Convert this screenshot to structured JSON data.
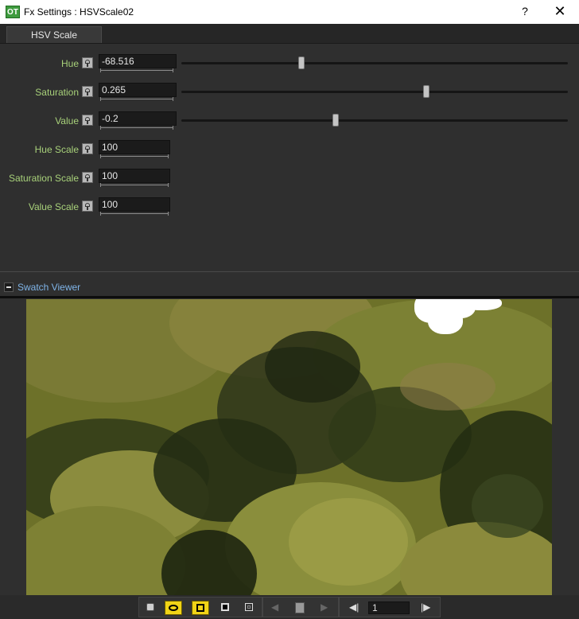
{
  "window": {
    "app_logo_text": "OT",
    "title": "Fx Settings : HSVScale02",
    "help_label": "?",
    "close_label": "✕"
  },
  "tabs": [
    {
      "label": "HSV Scale",
      "active": true
    }
  ],
  "params": [
    {
      "label": "Hue",
      "value": "-68.516",
      "has_slider": true,
      "slider_fraction": 0.31
    },
    {
      "label": "Saturation",
      "value": "0.265",
      "has_slider": true,
      "slider_fraction": 0.633
    },
    {
      "label": "Value",
      "value": "-0.2",
      "has_slider": true,
      "slider_fraction": 0.4
    },
    {
      "label": "Hue Scale",
      "value": "100",
      "has_slider": false
    },
    {
      "label": "Saturation Scale",
      "value": "100",
      "has_slider": false
    },
    {
      "label": "Value Scale",
      "value": "100",
      "has_slider": false
    }
  ],
  "swatch": {
    "title": "Swatch Viewer",
    "collapsed": false
  },
  "toolbar": {
    "frame_value": "1",
    "buttons": [
      {
        "icon": "camera-settings-icon",
        "active": false
      },
      {
        "icon": "eye-icon",
        "active": true
      },
      {
        "icon": "yellow-square-icon",
        "active": true
      },
      {
        "icon": "black-square-icon",
        "active": false
      },
      {
        "icon": "nested-square-icon",
        "active": false
      },
      {
        "icon": "previous-arrow-icon",
        "active": false,
        "disabled": true
      },
      {
        "icon": "lock-icon",
        "active": false,
        "disabled": true
      },
      {
        "icon": "next-arrow-icon",
        "active": false,
        "disabled": true
      },
      {
        "icon": "first-frame-icon",
        "active": false
      },
      {
        "icon": "last-frame-icon",
        "active": false
      }
    ]
  },
  "colors": {
    "param_label": "#a8d17a",
    "swatch_title": "#7fb4e8",
    "active_toggle": "#f1d417",
    "swatch_base": "#6d7129"
  }
}
